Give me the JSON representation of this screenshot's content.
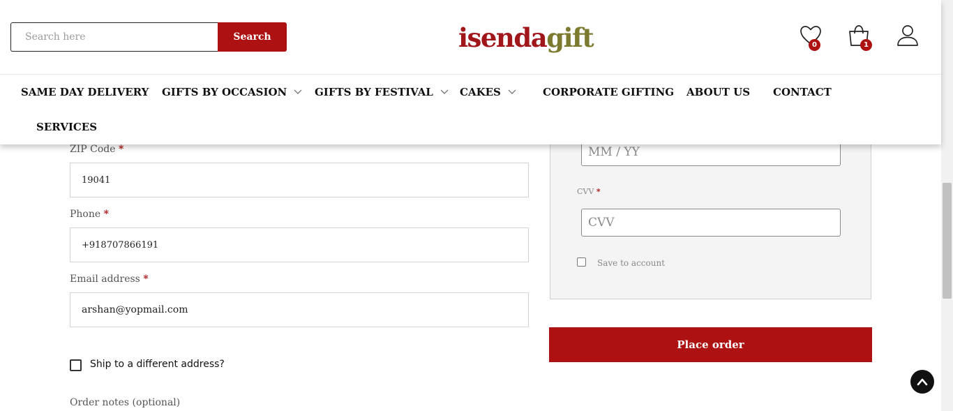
{
  "header": {
    "search_placeholder": "Search here",
    "search_button": "Search",
    "logo_part1": "isenda",
    "logo_part2": "gift",
    "wishlist_count": "0",
    "cart_count": "1",
    "icons": [
      "heart-icon",
      "shopping-bag-icon",
      "user-icon"
    ]
  },
  "nav": {
    "same_day": "SAME DAY DELIVERY",
    "occasion": "GIFTS BY OCCASION",
    "festival": "GIFTS BY FESTIVAL",
    "cakes": "CAKES",
    "corporate": "CORPORATE GIFTING",
    "about": "ABOUT US",
    "contact": "CONTACT",
    "services": "SERVICES"
  },
  "billing": {
    "zip_label": "ZIP Code",
    "zip_value": "19041",
    "phone_label": "Phone",
    "phone_value": "+918707866191",
    "email_label": "Email address",
    "email_value": "arshan@yopmail.com",
    "required_mark": "*",
    "ship_different": "Ship to a different address?",
    "order_notes": "Order notes (optional)"
  },
  "payment": {
    "expiry_placeholder": "MM / YY",
    "cvv_label": "CVV",
    "cvv_placeholder": "CVV",
    "save_label": "Save to account",
    "place_order": "Place order"
  },
  "colors": {
    "brand_red": "#ad1111",
    "logo_olive": "#7b7a2f"
  }
}
